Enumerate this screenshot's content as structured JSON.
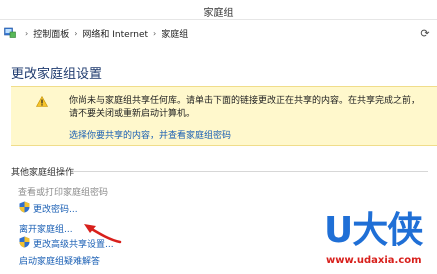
{
  "window": {
    "title": "家庭组"
  },
  "address_bar": {
    "crumbs": [
      "控制面板",
      "网络和 Internet",
      "家庭组"
    ]
  },
  "page": {
    "title": "更改家庭组设置"
  },
  "notice": {
    "message": "你尚未与家庭组共享任何库。请单击下面的链接更改正在共享的内容。在共享完成之前，请不要关闭或重新启动计算机。",
    "link": "选择你要共享的内容，并查看家庭组密码"
  },
  "other_actions": {
    "title": "其他家庭组操作",
    "items": [
      {
        "label": "查看或打印家庭组密码",
        "enabled": false,
        "shield": false
      },
      {
        "label": "更改密码...",
        "enabled": true,
        "shield": true
      },
      {
        "label": "离开家庭组...",
        "enabled": true,
        "shield": false
      },
      {
        "label": "更改高级共享设置...",
        "enabled": true,
        "shield": true
      },
      {
        "label": "启动家庭组疑难解答",
        "enabled": true,
        "shield": false
      }
    ]
  },
  "watermark": {
    "brand": "U大侠",
    "url": "www.udaxia.com"
  },
  "colors": {
    "link": "#1a5fb4",
    "title": "#1e3a6e",
    "notice_bg": "#fff8cc",
    "watermark_blue": "#1f6fd6",
    "watermark_red": "#d8201c"
  }
}
